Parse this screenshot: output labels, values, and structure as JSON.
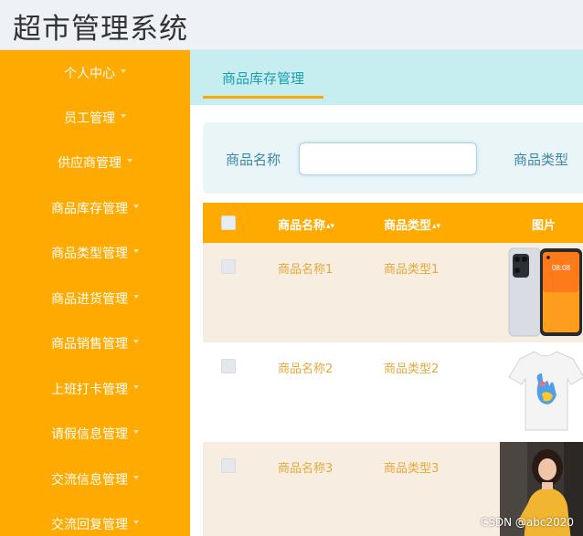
{
  "app": {
    "title": "超市管理系统"
  },
  "sidebar": {
    "items": [
      {
        "label": "个人中心"
      },
      {
        "label": "员工管理"
      },
      {
        "label": "供应商管理"
      },
      {
        "label": "商品库存管理"
      },
      {
        "label": "商品类型管理"
      },
      {
        "label": "商品进货管理"
      },
      {
        "label": "商品销售管理"
      },
      {
        "label": "上班打卡管理"
      },
      {
        "label": "请假信息管理"
      },
      {
        "label": "交流信息管理"
      },
      {
        "label": "交流回复管理"
      }
    ]
  },
  "tabs": [
    {
      "label": "商品库存管理",
      "active": true
    }
  ],
  "search": {
    "name_label": "商品名称",
    "name_value": "",
    "type_label": "商品类型"
  },
  "table": {
    "headers": {
      "name": "商品名称",
      "type": "商品类型",
      "image": "图片"
    },
    "rows": [
      {
        "name": "商品名称1",
        "type": "商品类型1",
        "image": "phone-photo"
      },
      {
        "name": "商品名称2",
        "type": "商品类型2",
        "image": "tshirt-photo"
      },
      {
        "name": "商品名称3",
        "type": "商品类型3",
        "image": "woman-photo"
      }
    ]
  },
  "colors": {
    "sidebar": "#ffaa00",
    "table_header": "#ffaa00",
    "tab_text": "#1a9fb0",
    "cell_text": "#e8a838"
  },
  "watermark": "CSDN @abc2020"
}
